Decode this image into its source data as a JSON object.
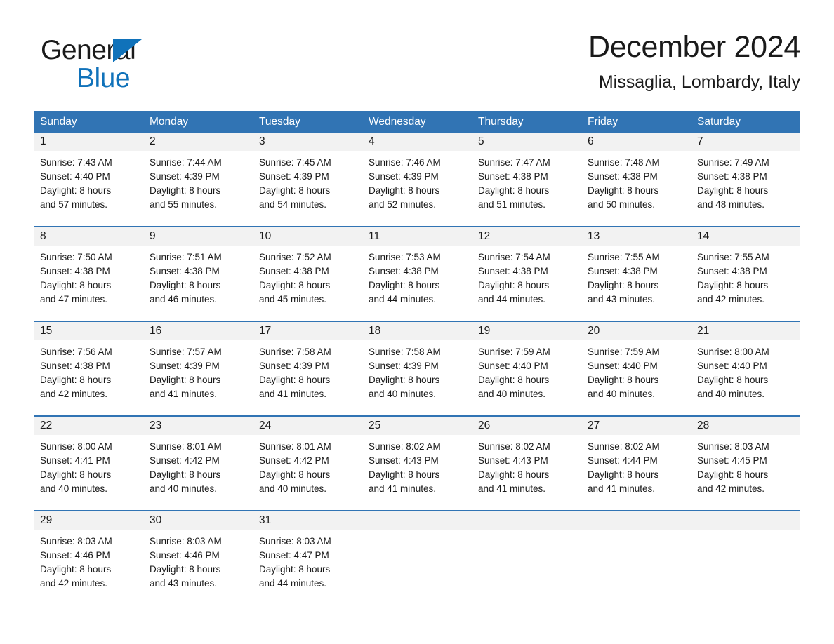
{
  "brand": {
    "name_dark": "General",
    "name_blue": "Blue",
    "triangle_color": "#1072BA"
  },
  "header": {
    "title": "December 2024",
    "subtitle": "Missaglia, Lombardy, Italy"
  },
  "theme": {
    "header_blue": "#3174B4",
    "daynum_gray": "#F2F2F2",
    "text": "#1a1a1a",
    "page_background": "#ffffff"
  },
  "weekday_headers": [
    "Sunday",
    "Monday",
    "Tuesday",
    "Wednesday",
    "Thursday",
    "Friday",
    "Saturday"
  ],
  "labels": {
    "sunrise_prefix": "Sunrise:",
    "sunset_prefix": "Sunset:",
    "daylight_prefix": "Daylight:"
  },
  "weeks": [
    {
      "days": [
        {
          "num": "1",
          "sunrise": "Sunrise: 7:43 AM",
          "sunset": "Sunset: 4:40 PM",
          "daylight1": "Daylight: 8 hours",
          "daylight2": "and 57 minutes."
        },
        {
          "num": "2",
          "sunrise": "Sunrise: 7:44 AM",
          "sunset": "Sunset: 4:39 PM",
          "daylight1": "Daylight: 8 hours",
          "daylight2": "and 55 minutes."
        },
        {
          "num": "3",
          "sunrise": "Sunrise: 7:45 AM",
          "sunset": "Sunset: 4:39 PM",
          "daylight1": "Daylight: 8 hours",
          "daylight2": "and 54 minutes."
        },
        {
          "num": "4",
          "sunrise": "Sunrise: 7:46 AM",
          "sunset": "Sunset: 4:39 PM",
          "daylight1": "Daylight: 8 hours",
          "daylight2": "and 52 minutes."
        },
        {
          "num": "5",
          "sunrise": "Sunrise: 7:47 AM",
          "sunset": "Sunset: 4:38 PM",
          "daylight1": "Daylight: 8 hours",
          "daylight2": "and 51 minutes."
        },
        {
          "num": "6",
          "sunrise": "Sunrise: 7:48 AM",
          "sunset": "Sunset: 4:38 PM",
          "daylight1": "Daylight: 8 hours",
          "daylight2": "and 50 minutes."
        },
        {
          "num": "7",
          "sunrise": "Sunrise: 7:49 AM",
          "sunset": "Sunset: 4:38 PM",
          "daylight1": "Daylight: 8 hours",
          "daylight2": "and 48 minutes."
        }
      ]
    },
    {
      "days": [
        {
          "num": "8",
          "sunrise": "Sunrise: 7:50 AM",
          "sunset": "Sunset: 4:38 PM",
          "daylight1": "Daylight: 8 hours",
          "daylight2": "and 47 minutes."
        },
        {
          "num": "9",
          "sunrise": "Sunrise: 7:51 AM",
          "sunset": "Sunset: 4:38 PM",
          "daylight1": "Daylight: 8 hours",
          "daylight2": "and 46 minutes."
        },
        {
          "num": "10",
          "sunrise": "Sunrise: 7:52 AM",
          "sunset": "Sunset: 4:38 PM",
          "daylight1": "Daylight: 8 hours",
          "daylight2": "and 45 minutes."
        },
        {
          "num": "11",
          "sunrise": "Sunrise: 7:53 AM",
          "sunset": "Sunset: 4:38 PM",
          "daylight1": "Daylight: 8 hours",
          "daylight2": "and 44 minutes."
        },
        {
          "num": "12",
          "sunrise": "Sunrise: 7:54 AM",
          "sunset": "Sunset: 4:38 PM",
          "daylight1": "Daylight: 8 hours",
          "daylight2": "and 44 minutes."
        },
        {
          "num": "13",
          "sunrise": "Sunrise: 7:55 AM",
          "sunset": "Sunset: 4:38 PM",
          "daylight1": "Daylight: 8 hours",
          "daylight2": "and 43 minutes."
        },
        {
          "num": "14",
          "sunrise": "Sunrise: 7:55 AM",
          "sunset": "Sunset: 4:38 PM",
          "daylight1": "Daylight: 8 hours",
          "daylight2": "and 42 minutes."
        }
      ]
    },
    {
      "days": [
        {
          "num": "15",
          "sunrise": "Sunrise: 7:56 AM",
          "sunset": "Sunset: 4:38 PM",
          "daylight1": "Daylight: 8 hours",
          "daylight2": "and 42 minutes."
        },
        {
          "num": "16",
          "sunrise": "Sunrise: 7:57 AM",
          "sunset": "Sunset: 4:39 PM",
          "daylight1": "Daylight: 8 hours",
          "daylight2": "and 41 minutes."
        },
        {
          "num": "17",
          "sunrise": "Sunrise: 7:58 AM",
          "sunset": "Sunset: 4:39 PM",
          "daylight1": "Daylight: 8 hours",
          "daylight2": "and 41 minutes."
        },
        {
          "num": "18",
          "sunrise": "Sunrise: 7:58 AM",
          "sunset": "Sunset: 4:39 PM",
          "daylight1": "Daylight: 8 hours",
          "daylight2": "and 40 minutes."
        },
        {
          "num": "19",
          "sunrise": "Sunrise: 7:59 AM",
          "sunset": "Sunset: 4:40 PM",
          "daylight1": "Daylight: 8 hours",
          "daylight2": "and 40 minutes."
        },
        {
          "num": "20",
          "sunrise": "Sunrise: 7:59 AM",
          "sunset": "Sunset: 4:40 PM",
          "daylight1": "Daylight: 8 hours",
          "daylight2": "and 40 minutes."
        },
        {
          "num": "21",
          "sunrise": "Sunrise: 8:00 AM",
          "sunset": "Sunset: 4:40 PM",
          "daylight1": "Daylight: 8 hours",
          "daylight2": "and 40 minutes."
        }
      ]
    },
    {
      "days": [
        {
          "num": "22",
          "sunrise": "Sunrise: 8:00 AM",
          "sunset": "Sunset: 4:41 PM",
          "daylight1": "Daylight: 8 hours",
          "daylight2": "and 40 minutes."
        },
        {
          "num": "23",
          "sunrise": "Sunrise: 8:01 AM",
          "sunset": "Sunset: 4:42 PM",
          "daylight1": "Daylight: 8 hours",
          "daylight2": "and 40 minutes."
        },
        {
          "num": "24",
          "sunrise": "Sunrise: 8:01 AM",
          "sunset": "Sunset: 4:42 PM",
          "daylight1": "Daylight: 8 hours",
          "daylight2": "and 40 minutes."
        },
        {
          "num": "25",
          "sunrise": "Sunrise: 8:02 AM",
          "sunset": "Sunset: 4:43 PM",
          "daylight1": "Daylight: 8 hours",
          "daylight2": "and 41 minutes."
        },
        {
          "num": "26",
          "sunrise": "Sunrise: 8:02 AM",
          "sunset": "Sunset: 4:43 PM",
          "daylight1": "Daylight: 8 hours",
          "daylight2": "and 41 minutes."
        },
        {
          "num": "27",
          "sunrise": "Sunrise: 8:02 AM",
          "sunset": "Sunset: 4:44 PM",
          "daylight1": "Daylight: 8 hours",
          "daylight2": "and 41 minutes."
        },
        {
          "num": "28",
          "sunrise": "Sunrise: 8:03 AM",
          "sunset": "Sunset: 4:45 PM",
          "daylight1": "Daylight: 8 hours",
          "daylight2": "and 42 minutes."
        }
      ]
    },
    {
      "days": [
        {
          "num": "29",
          "sunrise": "Sunrise: 8:03 AM",
          "sunset": "Sunset: 4:46 PM",
          "daylight1": "Daylight: 8 hours",
          "daylight2": "and 42 minutes."
        },
        {
          "num": "30",
          "sunrise": "Sunrise: 8:03 AM",
          "sunset": "Sunset: 4:46 PM",
          "daylight1": "Daylight: 8 hours",
          "daylight2": "and 43 minutes."
        },
        {
          "num": "31",
          "sunrise": "Sunrise: 8:03 AM",
          "sunset": "Sunset: 4:47 PM",
          "daylight1": "Daylight: 8 hours",
          "daylight2": "and 44 minutes."
        },
        {
          "num": "",
          "sunrise": "",
          "sunset": "",
          "daylight1": "",
          "daylight2": ""
        },
        {
          "num": "",
          "sunrise": "",
          "sunset": "",
          "daylight1": "",
          "daylight2": ""
        },
        {
          "num": "",
          "sunrise": "",
          "sunset": "",
          "daylight1": "",
          "daylight2": ""
        },
        {
          "num": "",
          "sunrise": "",
          "sunset": "",
          "daylight1": "",
          "daylight2": ""
        }
      ]
    }
  ]
}
